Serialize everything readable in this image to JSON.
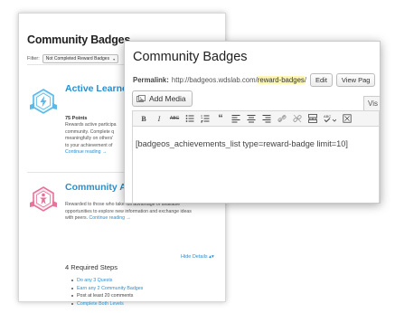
{
  "listing": {
    "title": "Community Badges",
    "filter_label": "Filter:",
    "filter_value": "Not Completed Reward Badges",
    "badge1": {
      "title": "Active Learne",
      "points": "75 Points",
      "desc_lines": [
        "Rewards active participa",
        "community. Complete q",
        "meaningfully on others' ",
        "to your achievement of "
      ],
      "more": "Continue reading →"
    },
    "badge2": {
      "title": "Community A",
      "desc_lines": [
        "Rewarded to those who take full advantage of available",
        "opportunities to explore new information and exchange ideas"
      ],
      "desc_tail": "with peers.",
      "more": "Continue reading →"
    },
    "hide_details": "Hide Details ▴▾",
    "steps_title": "4 Required Steps",
    "steps": [
      {
        "text": "Do any 3 Quests",
        "done": true
      },
      {
        "text": "Earn any 2 Community Badges",
        "done": true
      },
      {
        "text": "Post at least 20 comments",
        "done": false
      },
      {
        "text": "Complete Both Levels",
        "done": true
      }
    ]
  },
  "editor": {
    "title": "Community Badges",
    "permalink_label": "Permalink:",
    "permalink_base": "http://badgeos.wdslab.com/",
    "permalink_slug": "reward-badges",
    "permalink_end": "/",
    "edit_button": "Edit",
    "view_button": "View Pag",
    "add_media": "Add Media",
    "visual_tab": "Vis",
    "content": "[badgeos_achievements_list type=reward-badge limit=10]"
  },
  "icons": [
    "bold-icon",
    "italic-icon",
    "strikethrough-icon",
    "bullet-list-icon",
    "numbered-list-icon",
    "blockquote-icon",
    "align-left-icon",
    "align-center-icon",
    "align-right-icon",
    "link-icon",
    "unlink-icon",
    "read-more-icon",
    "spellcheck-icon",
    "fullscreen-icon",
    "add-media-icon"
  ],
  "colors": {
    "link": "#2a8fcf",
    "badge_blue": "#5ab9e8",
    "badge_pink": "#e8739a",
    "highlight": "#fff7b3"
  }
}
